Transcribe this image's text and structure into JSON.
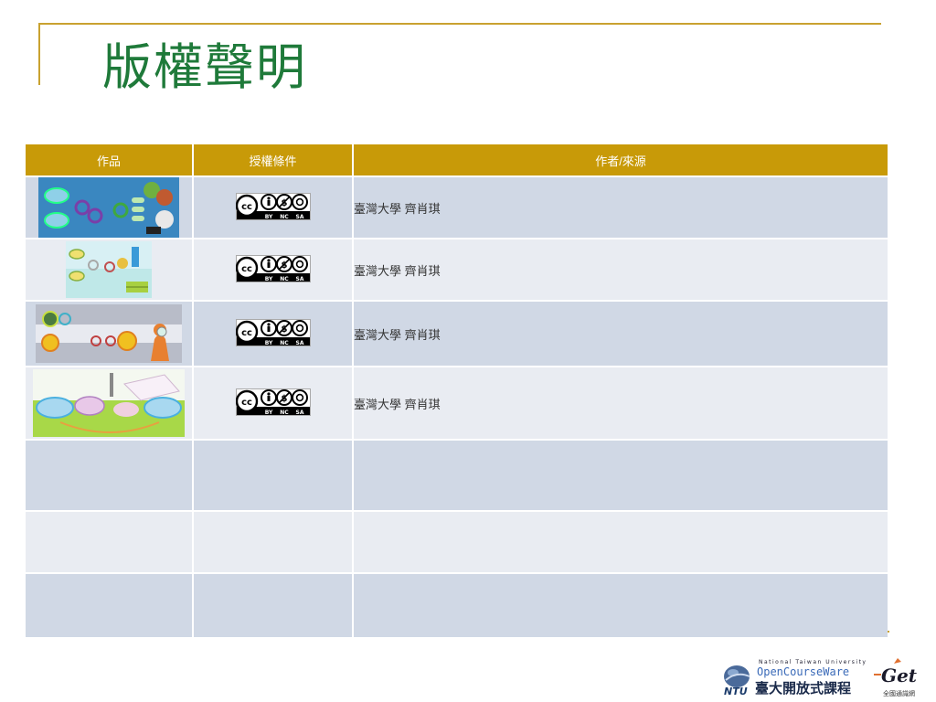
{
  "slide": {
    "title": "版權聲明"
  },
  "table": {
    "headers": [
      "作品",
      "授權條件",
      "作者/來源"
    ],
    "rows": [
      {
        "author": "臺灣大學 齊肖琪",
        "license": {
          "badges": [
            "BY",
            "NC",
            "SA"
          ]
        }
      },
      {
        "author": "臺灣大學 齊肖琪",
        "license": {
          "badges": [
            "BY",
            "NC",
            "SA"
          ]
        }
      },
      {
        "author": "臺灣大學 齊肖琪",
        "license": {
          "badges": [
            "BY",
            "NC",
            "SA"
          ]
        }
      },
      {
        "author": "臺灣大學 齊肖琪",
        "license": {
          "badges": [
            "BY",
            "NC",
            "SA"
          ]
        }
      },
      {
        "author": ""
      },
      {
        "author": ""
      },
      {
        "author": ""
      }
    ]
  },
  "footer": {
    "ocw_en_top": "National Taiwan University",
    "ocw_en": "OpenCourseWare",
    "ocw_zh": "臺大開放式課程",
    "ntu_mark": "NTU",
    "get_mark": "Get",
    "get_sub": "全國通識網"
  },
  "colors": {
    "title": "#1f7a3a",
    "header_bg": "#c89a08",
    "row_odd": "#d0d8e5",
    "row_even": "#e9ecf2",
    "frame": "#c9a230"
  }
}
